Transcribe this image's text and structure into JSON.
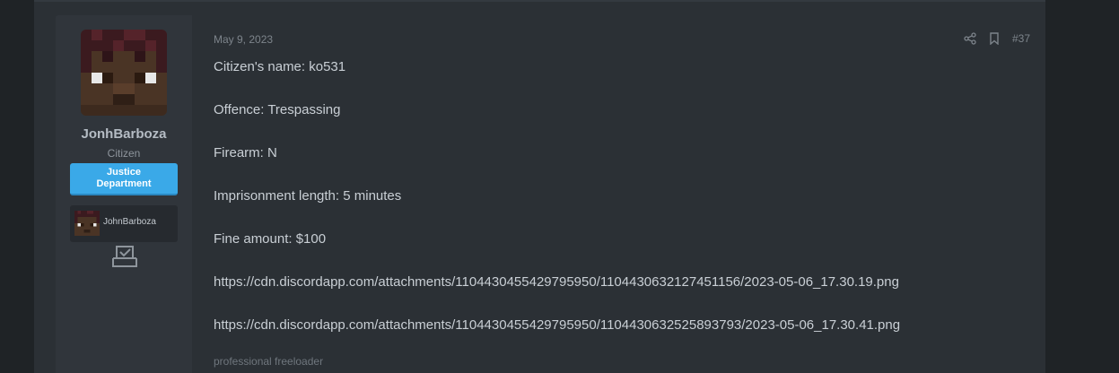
{
  "post": {
    "date": "May 9, 2023",
    "number": "#37",
    "lines": [
      "Citizen's name: ko531",
      "Offence: Trespassing",
      "Firearm: N",
      "Imprisonment length: 5 minutes",
      "Fine amount: $100",
      "https://cdn.discordapp.com/attachments/1104430455429795950/1104430632127451156/2023-05-06_17.30.19.png",
      "https://cdn.discordapp.com/attachments/1104430455429795950/1104430632525893793/2023-05-06_17.30.41.png"
    ],
    "signature": "professional freeloader"
  },
  "user": {
    "name": "JonhBarboza",
    "title": "Citizen",
    "banner": "Justice Department",
    "minecraft_name": "JohnBarboza"
  },
  "icons": {
    "share": "share-icon",
    "bookmark": "bookmark-icon",
    "badge": "inbox-check-icon"
  },
  "colors": {
    "banner": "#3aa9e8",
    "page_background": "#1f2326",
    "post_background": "#2b3035",
    "user_column": "#30353b"
  }
}
